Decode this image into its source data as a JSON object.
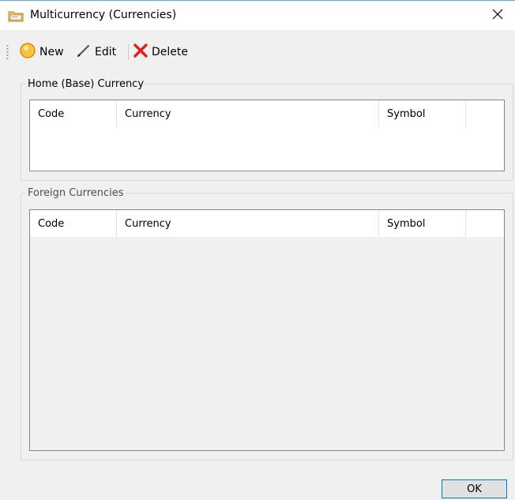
{
  "window": {
    "title": "Multicurrency (Currencies)",
    "icon": "folder-icon",
    "close_icon": "close-icon"
  },
  "toolbar": {
    "new_label": "New",
    "edit_label": "Edit",
    "delete_label": "Delete",
    "new_icon": "new-sun-icon",
    "edit_icon": "pencil-icon",
    "delete_icon": "red-x-icon"
  },
  "home_currency": {
    "legend": "Home (Base) Currency",
    "columns": [
      "Code",
      "Currency",
      "Symbol"
    ]
  },
  "foreign_currencies": {
    "legend": "Foreign Currencies",
    "columns": [
      "Code",
      "Currency",
      "Symbol"
    ]
  },
  "footer": {
    "ok_label": "OK"
  },
  "colors": {
    "accent": "#0078d7",
    "delete": "#e02020",
    "new": "#f5a623"
  }
}
